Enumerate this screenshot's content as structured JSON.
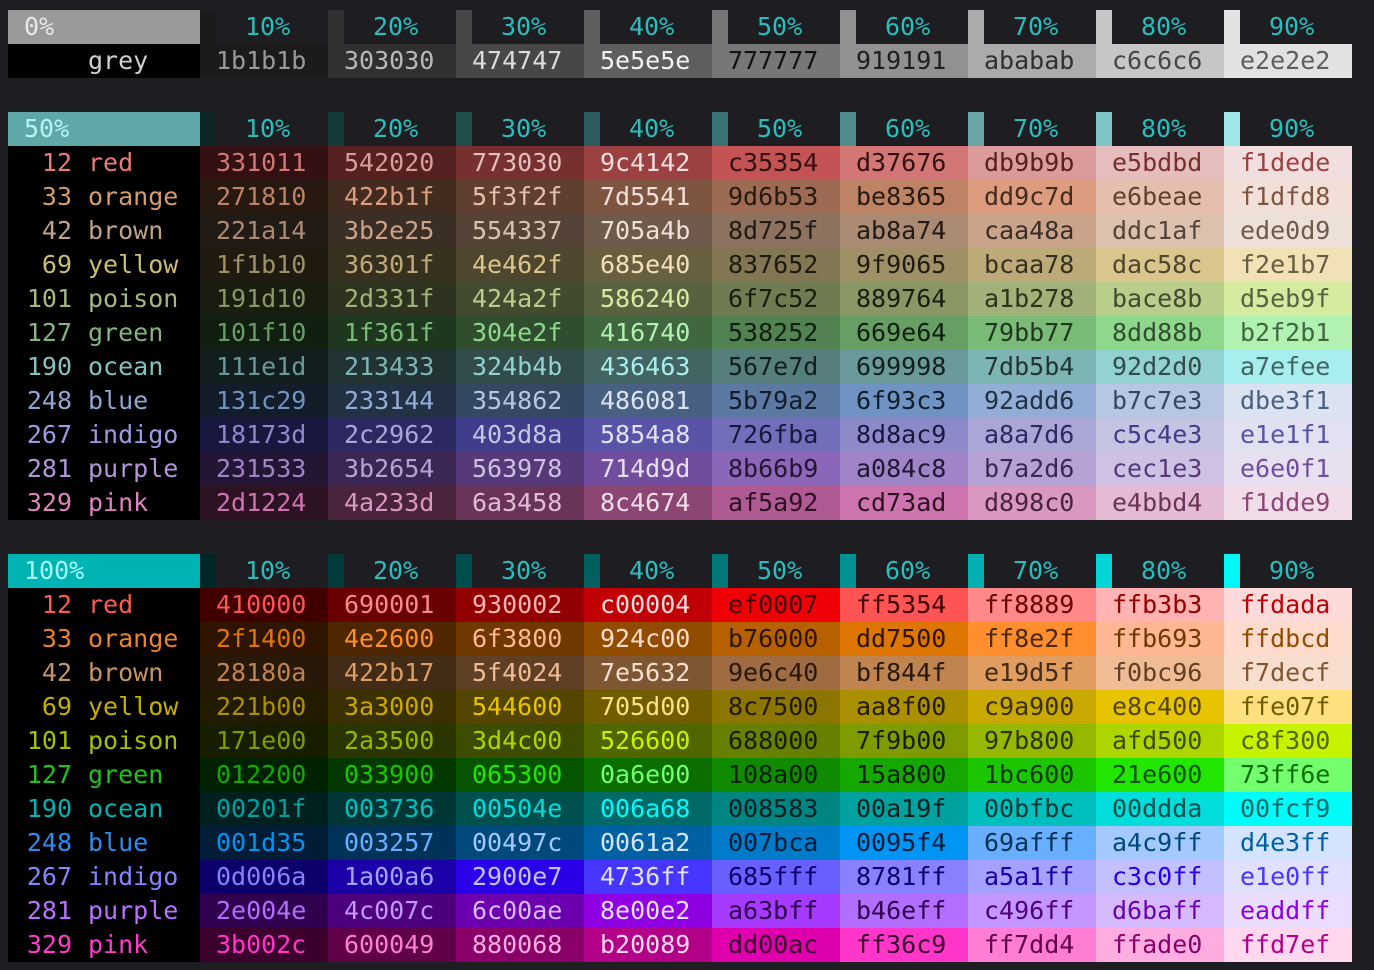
{
  "percent_headers": [
    "10%",
    "20%",
    "30%",
    "40%",
    "50%",
    "60%",
    "70%",
    "80%",
    "90%"
  ],
  "grey": {
    "header": "0%",
    "header_bg": "#9a9a9a",
    "header_fg": "#e8e8e8",
    "chips": [
      "#1b1b1b",
      "#303030",
      "#474747",
      "#5e5e5e",
      "#777777",
      "#919191",
      "#ababab",
      "#c6c6c6",
      "#e2e2e2"
    ],
    "row": {
      "label": "grey",
      "label_color": "#d0d0d0",
      "cells": [
        {
          "text": "1b1b1b",
          "bg": "#1b1b1b",
          "fg": "#9a9a9a"
        },
        {
          "text": "303030",
          "bg": "#303030",
          "fg": "#b8b8b8"
        },
        {
          "text": "474747",
          "bg": "#474747",
          "fg": "#dcdcdc"
        },
        {
          "text": "5e5e5e",
          "bg": "#5e5e5e",
          "fg": "#f2f2f2"
        },
        {
          "text": "777777",
          "bg": "#777777",
          "fg": "#111111"
        },
        {
          "text": "919191",
          "bg": "#919191",
          "fg": "#1e1e1e"
        },
        {
          "text": "ababab",
          "bg": "#ababab",
          "fg": "#303030"
        },
        {
          "text": "c6c6c6",
          "bg": "#c6c6c6",
          "fg": "#474747"
        },
        {
          "text": "e2e2e2",
          "bg": "#e2e2e2",
          "fg": "#5e5e5e"
        }
      ]
    }
  },
  "sat50": {
    "header": "50%",
    "header_bg": "#5fa8a8",
    "header_fg": "#b4f5f5",
    "chips": [
      "#0e2626",
      "#163a3a",
      "#214d4d",
      "#2c5e5e",
      "#3a7373",
      "#4f8c8c",
      "#68a6a6",
      "#7fc4c4",
      "#a0e6e6"
    ],
    "rows": [
      {
        "num": "12",
        "name": "red",
        "color": "#e97a78",
        "cells": [
          "331011",
          "542020",
          "773030",
          "9c4142",
          "c35354",
          "d37676",
          "db9b9b",
          "e5bdbd",
          "f1dede"
        ]
      },
      {
        "num": "33",
        "name": "orange",
        "color": "#d39c6e",
        "cells": [
          "271810",
          "422b1f",
          "5f3f2f",
          "7d5541",
          "9d6b53",
          "be8365",
          "dd9c7d",
          "e6beae",
          "f1dfd8"
        ]
      },
      {
        "num": "42",
        "name": "brown",
        "color": "#bfa28b",
        "cells": [
          "221a14",
          "3b2e25",
          "554337",
          "705a4b",
          "8d725f",
          "ab8a74",
          "caa48a",
          "ddc1af",
          "ede0d9"
        ]
      },
      {
        "num": "69",
        "name": "yellow",
        "color": "#c9bd75",
        "cells": [
          "1f1b10",
          "36301f",
          "4e462f",
          "685e40",
          "837652",
          "9f9065",
          "bcaa78",
          "dac58c",
          "f2e1b7"
        ]
      },
      {
        "num": "101",
        "name": "poison",
        "color": "#a4b97d",
        "cells": [
          "191d10",
          "2d331f",
          "424a2f",
          "586240",
          "6f7c52",
          "889764",
          "a1b278",
          "bace8b",
          "d5eb9f"
        ]
      },
      {
        "num": "127",
        "name": "green",
        "color": "#83b67e",
        "cells": [
          "101f10",
          "1f361f",
          "304e2f",
          "416740",
          "538252",
          "669e64",
          "79bb77",
          "8dd88b",
          "b2f2b1"
        ]
      },
      {
        "num": "190",
        "name": "ocean",
        "color": "#86c1c1",
        "cells": [
          "111e1d",
          "213433",
          "324b4b",
          "436463",
          "567e7d",
          "699998",
          "7db5b4",
          "92d2d0",
          "a7efee"
        ]
      },
      {
        "num": "248",
        "name": "blue",
        "color": "#8fa7d5",
        "cells": [
          "131c29",
          "233144",
          "354862",
          "486081",
          "5b79a2",
          "6f93c3",
          "92add6",
          "b7c7e3",
          "dbe3f1"
        ]
      },
      {
        "num": "267",
        "name": "indigo",
        "color": "#9c9ae3",
        "cells": [
          "18173d",
          "2c2962",
          "403d8a",
          "5854a8",
          "726fba",
          "8d8ac9",
          "a8a7d6",
          "c5c4e3",
          "e1e1f1"
        ]
      },
      {
        "num": "281",
        "name": "purple",
        "color": "#b395d8",
        "cells": [
          "231533",
          "3b2654",
          "563978",
          "714d9d",
          "8b66b9",
          "a084c8",
          "b7a2d6",
          "cec1e3",
          "e6e0f1"
        ]
      },
      {
        "num": "329",
        "name": "pink",
        "color": "#dd85bd",
        "cells": [
          "2d1224",
          "4a233d",
          "6a3458",
          "8c4674",
          "af5a92",
          "cd73ad",
          "d898c0",
          "e4bbd4",
          "f1dde9"
        ]
      }
    ]
  },
  "sat100": {
    "header": "100%",
    "header_bg": "#00b3b3",
    "header_fg": "#a6ffff",
    "chips": [
      "#002727",
      "#003a3a",
      "#004d4d",
      "#005f5f",
      "#007878",
      "#009292",
      "#00b0b0",
      "#00d4d4",
      "#00f7f7"
    ],
    "rows": [
      {
        "num": "12",
        "name": "red",
        "color": "#ff5a52",
        "cells": [
          "410000",
          "690001",
          "930002",
          "c00004",
          "ef0007",
          "ff5354",
          "ff8889",
          "ffb3b3",
          "ffdada"
        ]
      },
      {
        "num": "33",
        "name": "orange",
        "color": "#e98330",
        "cells": [
          "2f1400",
          "4e2600",
          "6f3800",
          "924c00",
          "b76000",
          "dd7500",
          "ff8e2f",
          "ffb693",
          "ffdbcd"
        ]
      },
      {
        "num": "42",
        "name": "brown",
        "color": "#c79564",
        "cells": [
          "28180a",
          "422b17",
          "5f4024",
          "7e5632",
          "9e6c40",
          "bf844f",
          "e19d5f",
          "f0bc96",
          "f7decf"
        ]
      },
      {
        "num": "69",
        "name": "yellow",
        "color": "#c7ad00",
        "cells": [
          "221b00",
          "3a3000",
          "544600",
          "705d00",
          "8c7500",
          "aa8f00",
          "c9a900",
          "e8c400",
          "ffe07f"
        ]
      },
      {
        "num": "101",
        "name": "poison",
        "color": "#a6bf00",
        "cells": [
          "171e00",
          "2a3500",
          "3d4c00",
          "526600",
          "688000",
          "7f9b00",
          "97b800",
          "afd500",
          "c8f300"
        ]
      },
      {
        "num": "127",
        "name": "green",
        "color": "#21c21e",
        "cells": [
          "012200",
          "033900",
          "065300",
          "0a6e00",
          "108a00",
          "15a800",
          "1bc600",
          "21e600",
          "73ff6e"
        ]
      },
      {
        "num": "190",
        "name": "ocean",
        "color": "#00b4b4",
        "cells": [
          "00201f",
          "003736",
          "00504e",
          "006a68",
          "008583",
          "00a19f",
          "00bfbc",
          "00ddda",
          "00fcf9"
        ]
      },
      {
        "num": "248",
        "name": "blue",
        "color": "#2f8bf0",
        "cells": [
          "001d35",
          "003257",
          "00497c",
          "0061a2",
          "007bca",
          "0095f4",
          "69afff",
          "a4c9ff",
          "d4e3ff"
        ]
      },
      {
        "num": "267",
        "name": "indigo",
        "color": "#8386ff",
        "cells": [
          "0d006a",
          "1a00a6",
          "2900e7",
          "4736ff",
          "685fff",
          "8781ff",
          "a5a1ff",
          "c3c0ff",
          "e1e0ff"
        ]
      },
      {
        "num": "281",
        "name": "purple",
        "color": "#b971ff",
        "cells": [
          "2e004e",
          "4c007c",
          "6c00ae",
          "8e00e2",
          "a63bff",
          "b46eff",
          "c496ff",
          "d6baff",
          "eaddff"
        ]
      },
      {
        "num": "329",
        "name": "pink",
        "color": "#ff3ccc",
        "cells": [
          "3b002c",
          "600049",
          "880068",
          "b20089",
          "dd00ac",
          "ff36c9",
          "ff7dd4",
          "ffade0",
          "ffd7ef"
        ]
      }
    ]
  }
}
